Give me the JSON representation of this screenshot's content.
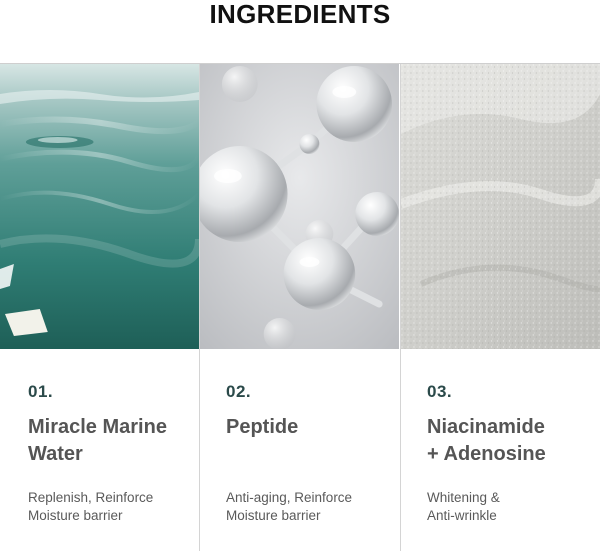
{
  "header": {
    "title": "INGREDIENTS"
  },
  "ingredients": [
    {
      "number": "01.",
      "name_line1": "Miracle Marine",
      "name_line2": "Water",
      "desc_line1": "Replenish, Reinforce",
      "desc_line2": "Moisture barrier",
      "image": "ocean-water-image"
    },
    {
      "number": "02.",
      "name_line1": "Peptide",
      "name_line2": "",
      "desc_line1": "Anti-aging, Reinforce",
      "desc_line2": "Moisture barrier",
      "image": "molecule-image"
    },
    {
      "number": "03.",
      "name_line1": "Niacinamide",
      "name_line2": "+ Adenosine",
      "desc_line1": "Whitening &",
      "desc_line2": "Anti-wrinkle",
      "image": "powder-image"
    }
  ],
  "colors": {
    "number": "#2b4a4a",
    "name": "#555555",
    "desc": "#5a5a5a",
    "title": "#111111"
  }
}
